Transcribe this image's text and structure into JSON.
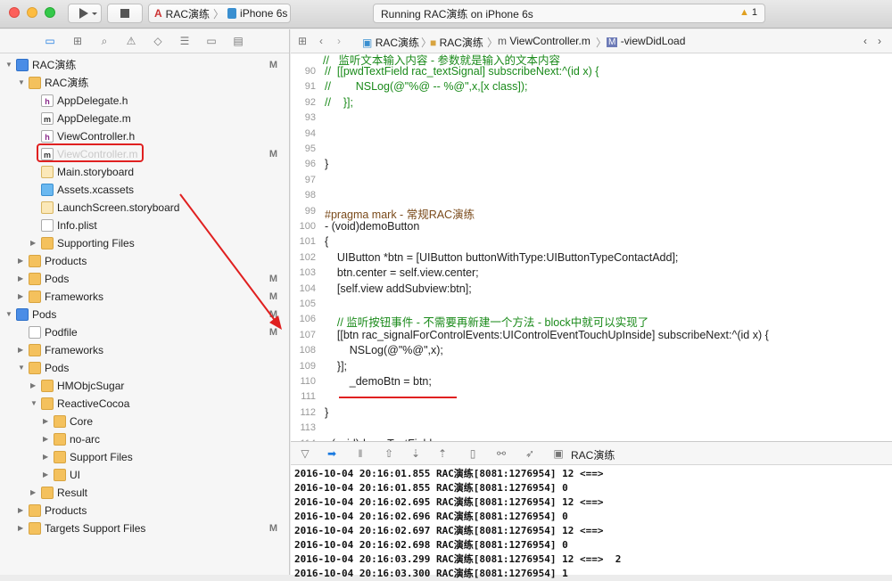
{
  "toolbar": {
    "scheme_target": "RAC演练",
    "scheme_device": "iPhone 6s",
    "activity": "Running RAC演练 on iPhone 6s",
    "warning_count": "1"
  },
  "tree": [
    {
      "label": "RAC演练",
      "type": "proj",
      "level": 0,
      "open": true,
      "flag": "M"
    },
    {
      "label": "RAC演练",
      "type": "folder",
      "level": 1,
      "open": true,
      "flag": ""
    },
    {
      "label": "AppDelegate.h",
      "type": "h",
      "level": 2,
      "flag": ""
    },
    {
      "label": "AppDelegate.m",
      "type": "m",
      "level": 2,
      "flag": ""
    },
    {
      "label": "ViewController.h",
      "type": "h",
      "level": 2,
      "flag": ""
    },
    {
      "label": "ViewController.m",
      "type": "m",
      "level": 2,
      "flag": "M",
      "selected": true
    },
    {
      "label": "Main.storyboard",
      "type": "sb",
      "level": 2,
      "flag": ""
    },
    {
      "label": "Assets.xcassets",
      "type": "xc",
      "level": 2,
      "flag": ""
    },
    {
      "label": "LaunchScreen.storyboard",
      "type": "sb",
      "level": 2,
      "flag": ""
    },
    {
      "label": "Info.plist",
      "type": "pl",
      "level": 2,
      "flag": ""
    },
    {
      "label": "Supporting Files",
      "type": "folder",
      "level": 2,
      "open": false,
      "flag": ""
    },
    {
      "label": "Products",
      "type": "folder",
      "level": 1,
      "open": false,
      "flag": ""
    },
    {
      "label": "Pods",
      "type": "folder",
      "level": 1,
      "open": false,
      "flag": "M"
    },
    {
      "label": "Frameworks",
      "type": "folder",
      "level": 1,
      "open": false,
      "flag": "M"
    },
    {
      "label": "Pods",
      "type": "proj",
      "level": 0,
      "open": true,
      "flag": "M"
    },
    {
      "label": "Podfile",
      "type": "pl",
      "level": 1,
      "flag": "M"
    },
    {
      "label": "Frameworks",
      "type": "folder",
      "level": 1,
      "open": false,
      "flag": ""
    },
    {
      "label": "Pods",
      "type": "folder",
      "level": 1,
      "open": true,
      "flag": ""
    },
    {
      "label": "HMObjcSugar",
      "type": "folder",
      "level": 2,
      "open": false,
      "flag": ""
    },
    {
      "label": "ReactiveCocoa",
      "type": "folder",
      "level": 2,
      "open": true,
      "flag": ""
    },
    {
      "label": "Core",
      "type": "folder",
      "level": 3,
      "open": false,
      "flag": ""
    },
    {
      "label": "no-arc",
      "type": "folder",
      "level": 3,
      "open": false,
      "flag": ""
    },
    {
      "label": "Support Files",
      "type": "folder",
      "level": 3,
      "open": false,
      "flag": ""
    },
    {
      "label": "UI",
      "type": "folder",
      "level": 3,
      "open": false,
      "flag": ""
    },
    {
      "label": "Result",
      "type": "folder",
      "level": 2,
      "open": false,
      "flag": ""
    },
    {
      "label": "Products",
      "type": "folder",
      "level": 1,
      "open": false,
      "flag": ""
    },
    {
      "label": "Targets Support Files",
      "type": "folder",
      "level": 1,
      "open": false,
      "flag": "M"
    }
  ],
  "jumpbar": [
    "RAC演练",
    "RAC演练",
    "ViewController.m",
    "-viewDidLoad"
  ],
  "code": [
    {
      "n": "90",
      "t": "//  [[pwdTextField rac_textSignal] subscribeNext:^(id x) {",
      "c": "green"
    },
    {
      "n": "91",
      "t": "//        NSLog(@\"%@ -- %@\",x,[x class]);",
      "c": "green"
    },
    {
      "n": "92",
      "t": "//    }];",
      "c": "green"
    },
    {
      "n": "93",
      "t": "",
      "c": ""
    },
    {
      "n": "94",
      "t": "",
      "c": ""
    },
    {
      "n": "95",
      "t": "",
      "c": ""
    },
    {
      "n": "96",
      "t": "}",
      "c": ""
    },
    {
      "n": "97",
      "t": "",
      "c": ""
    },
    {
      "n": "98",
      "t": "",
      "c": ""
    },
    {
      "n": "99",
      "t": "#pragma mark - 常规RAC演练",
      "c": "brown"
    },
    {
      "n": "100",
      "t": "- (void)demoButton",
      "c": ""
    },
    {
      "n": "101",
      "t": "{",
      "c": ""
    },
    {
      "n": "102",
      "t": "    UIButton *btn = [UIButton buttonWithType:UIButtonTypeContactAdd];",
      "c": ""
    },
    {
      "n": "103",
      "t": "    btn.center = self.view.center;",
      "c": ""
    },
    {
      "n": "104",
      "t": "    [self.view addSubview:btn];",
      "c": ""
    },
    {
      "n": "105",
      "t": "",
      "c": ""
    },
    {
      "n": "106",
      "t": "    // 监听按钮事件 - 不需要再新建一个方法 - block中就可以实现了",
      "c": "green"
    },
    {
      "n": "107",
      "t": "    [[btn rac_signalForControlEvents:UIControlEventTouchUpInside] subscribeNext:^(id x) {",
      "c": ""
    },
    {
      "n": "108",
      "t": "        NSLog(@\"%@\",x);",
      "c": ""
    },
    {
      "n": "109",
      "t": "    }];",
      "c": ""
    },
    {
      "n": "110",
      "t": "        _demoBtn = btn;",
      "c": ""
    },
    {
      "n": "111",
      "t": "",
      "c": ""
    },
    {
      "n": "112",
      "t": "}",
      "c": ""
    },
    {
      "n": "113",
      "t": "",
      "c": ""
    },
    {
      "n": "114",
      "t": "- (void)demoTextField",
      "c": ""
    }
  ],
  "debug": {
    "target": "RAC演练"
  },
  "console": [
    "2016-10-04 20:16:01.855 RAC演练[8081:1276954] 12 <==>",
    "2016-10-04 20:16:01.855 RAC演练[8081:1276954] 0",
    "2016-10-04 20:16:02.695 RAC演练[8081:1276954] 12 <==>",
    "2016-10-04 20:16:02.696 RAC演练[8081:1276954] 0",
    "2016-10-04 20:16:02.697 RAC演练[8081:1276954] 12 <==>",
    "2016-10-04 20:16:02.698 RAC演练[8081:1276954] 0",
    "2016-10-04 20:16:03.299 RAC演练[8081:1276954] 12 <==>  2",
    "2016-10-04 20:16:03.300 RAC演练[8081:1276954] 1"
  ],
  "colors": {
    "annotation": "#e02020",
    "selection_box": "#e02020"
  }
}
